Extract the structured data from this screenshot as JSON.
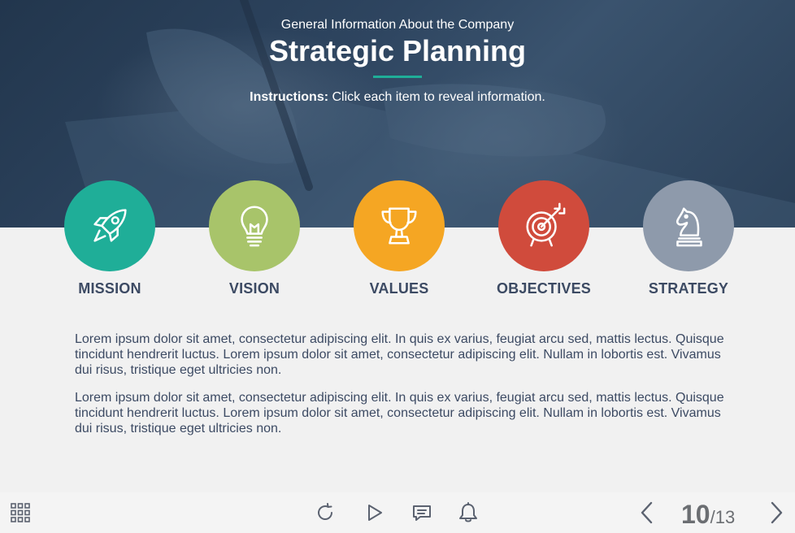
{
  "header": {
    "subtitle": "General Information About the Company",
    "title": "Strategic Planning",
    "instructions_bold": "Instructions:",
    "instructions_text": " Click each item to reveal information."
  },
  "items": [
    {
      "label": "MISSION",
      "icon": "rocket-icon",
      "color": "#1fae98"
    },
    {
      "label": "VISION",
      "icon": "lightbulb-icon",
      "color": "#a8c46a"
    },
    {
      "label": "VALUES",
      "icon": "trophy-icon",
      "color": "#f5a623"
    },
    {
      "label": "OBJECTIVES",
      "icon": "target-icon",
      "color": "#d04b3c"
    },
    {
      "label": "STRATEGY",
      "icon": "chess-knight-icon",
      "color": "#8e9aab"
    }
  ],
  "content": {
    "paragraphs": [
      "Lorem ipsum dolor sit amet, consectetur adipiscing elit. In quis ex varius, feugiat arcu sed, mattis lectus. Quisque tincidunt hendrerit luctus. Lorem ipsum dolor sit amet, consectetur adipiscing elit. Nullam in lobortis est. Vivamus dui risus, tristique eget ultricies non.",
      "Lorem ipsum dolor sit amet, consectetur adipiscing elit. In quis ex varius, feugiat arcu sed, mattis lectus. Quisque tincidunt hendrerit luctus. Lorem ipsum dolor sit amet, consectetur adipiscing elit. Nullam in lobortis est. Vivamus dui risus, tristique eget ultricies non."
    ]
  },
  "player": {
    "menu_icon": "grid-menu-icon",
    "controls": [
      "replay-icon",
      "play-icon",
      "comment-icon",
      "bell-icon"
    ],
    "current_page": "10",
    "total_pages": "/13",
    "accent": "#1fae98"
  }
}
